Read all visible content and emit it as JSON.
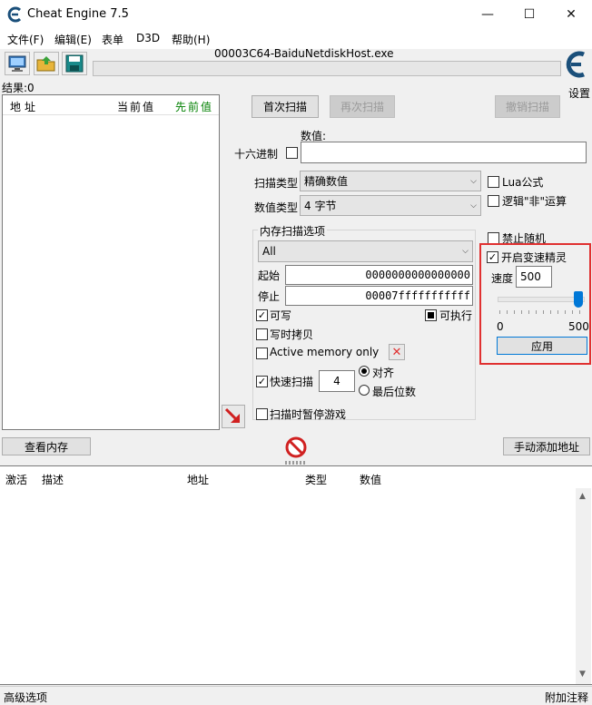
{
  "app": {
    "title": "Cheat Engine 7.5",
    "process_name": "00003C64-BaiduNetdiskHost.exe",
    "settings_label": "设置"
  },
  "menu": [
    "文件(F)",
    "编辑(E)",
    "表单",
    "D3D",
    "帮助(H)"
  ],
  "results": {
    "label": "结果:0"
  },
  "result_columns": [
    "地址",
    "当前值",
    "先前值"
  ],
  "scan_buttons": {
    "first_scan": "首次扫描",
    "next_scan": "再次扫描",
    "undo_scan": "撤销扫描"
  },
  "value": {
    "label": "数值:",
    "hex_label": "十六进制",
    "value": ""
  },
  "scan_type": {
    "label": "扫描类型",
    "selected": "精确数值"
  },
  "value_type": {
    "label": "数值类型",
    "selected": "4 字节"
  },
  "right_options": {
    "lua": "Lua公式",
    "not_op": "逻辑\"非\"运算",
    "no_random": "禁止随机"
  },
  "speedhack": {
    "enable_label": "开启变速精灵",
    "speed_label": "速度",
    "speed_value": "500",
    "slider_value": 500,
    "slider_min": "0",
    "slider_max": "500",
    "apply_label": "应用"
  },
  "mem_options": {
    "title": "内存扫描选项",
    "region": "All",
    "start_label": "起始",
    "start_value": "0000000000000000",
    "stop_label": "停止",
    "stop_value": "00007fffffffffff",
    "writable": "可写",
    "executable": "可执行",
    "copy_on_write": "写时拷贝",
    "active_memory": "Active memory only",
    "fast_scan": "快速扫描",
    "fast_scan_value": "4",
    "align": "对齐",
    "last_digits": "最后位数",
    "pause_game": "扫描时暂停游戏"
  },
  "buttons": {
    "view_memory": "查看内存",
    "add_address": "手动添加地址"
  },
  "table_columns": [
    "激活",
    "描述",
    "地址",
    "类型",
    "数值"
  ],
  "status": {
    "left": "高级选项",
    "right": "附加注释"
  },
  "colors": {
    "accent_blue": "#0078d7",
    "highlight_red": "#e03030",
    "prev_value_green": "#008000"
  }
}
